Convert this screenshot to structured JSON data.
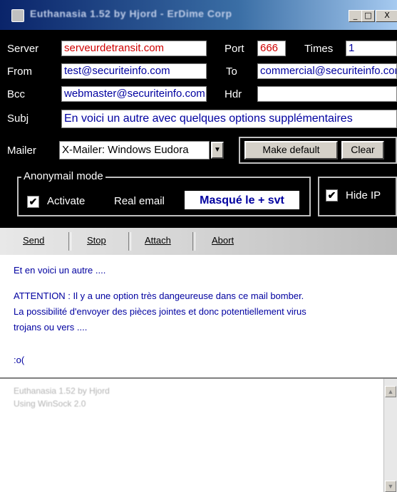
{
  "window": {
    "title": "Euthanasia 1.52 by Hjord - ErDime Corp"
  },
  "title_buttons": {
    "minimize": "_",
    "maximize": "□",
    "close": "X"
  },
  "labels": {
    "server": "Server",
    "port": "Port",
    "times": "Times",
    "from": "From",
    "to": "To",
    "bcc": "Bcc",
    "hdr": "Hdr",
    "subj": "Subj",
    "mailer": "Mailer",
    "anonymail": "Anonymail mode",
    "activate": "Activate",
    "real_email": "Real email",
    "hide_ip": "Hide IP"
  },
  "fields": {
    "server": "serveurdetransit.com",
    "port": "666",
    "times": "1",
    "from": "test@securiteinfo.com",
    "to": "commercial@securiteinfo.com",
    "bcc": "webmaster@securiteinfo.com",
    "hdr": "",
    "subj": "En voici un autre avec quelques options supplémentaires",
    "mailer": "X-Mailer: Windows Eudora",
    "real_email": "Masqué le + svt"
  },
  "checkboxes": {
    "activate": true,
    "hide_ip": true
  },
  "buttons": {
    "make_default": "Make default",
    "clear": "Clear"
  },
  "toolbar": {
    "send": "Send",
    "stop": "Stop",
    "attach": "Attach",
    "abort": "Abort"
  },
  "message": {
    "lines": [
      "Et en voici un autre ....",
      "",
      "ATTENTION : Il y a une option très dangeureuse dans ce mail bomber.",
      "La possibilité d'envoyer des pièces jointes et donc potentiellement virus",
      "trojans ou vers ....",
      "",
      ":o("
    ]
  },
  "log": {
    "lines": [
      "Euthanasia 1.52 by Hjord",
      "Using WinSock 2.0"
    ]
  },
  "colors": {
    "background": "#000000",
    "field_red": "#d00000",
    "field_blue": "#0000a0",
    "title_blue": "#0a246a"
  }
}
